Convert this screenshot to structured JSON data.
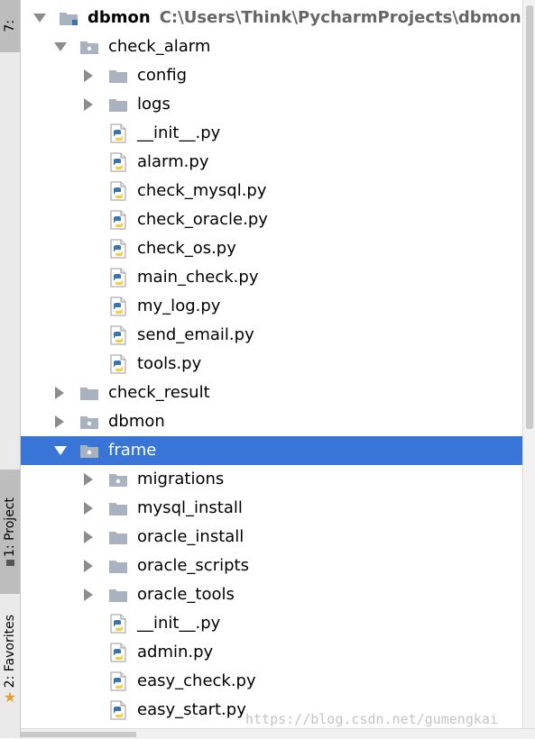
{
  "sidebar": {
    "top_tab": "7:",
    "project_tab": "1: Project",
    "favorites_tab": "2: Favorites"
  },
  "tree": [
    {
      "name": "dbmon",
      "path": "C:\\Users\\Think\\PycharmProjects\\dbmon",
      "type": "module",
      "level": 0,
      "state": "expanded",
      "bold": true
    },
    {
      "name": "check_alarm",
      "type": "package",
      "level": 1,
      "state": "expanded"
    },
    {
      "name": "config",
      "type": "folder",
      "level": 2,
      "state": "collapsed"
    },
    {
      "name": "logs",
      "type": "folder",
      "level": 2,
      "state": "collapsed"
    },
    {
      "name": "__init__.py",
      "type": "python",
      "level": 2,
      "state": "leaf"
    },
    {
      "name": "alarm.py",
      "type": "python",
      "level": 2,
      "state": "leaf"
    },
    {
      "name": "check_mysql.py",
      "type": "python",
      "level": 2,
      "state": "leaf"
    },
    {
      "name": "check_oracle.py",
      "type": "python",
      "level": 2,
      "state": "leaf"
    },
    {
      "name": "check_os.py",
      "type": "python",
      "level": 2,
      "state": "leaf"
    },
    {
      "name": "main_check.py",
      "type": "python",
      "level": 2,
      "state": "leaf"
    },
    {
      "name": "my_log.py",
      "type": "python",
      "level": 2,
      "state": "leaf"
    },
    {
      "name": "send_email.py",
      "type": "python",
      "level": 2,
      "state": "leaf"
    },
    {
      "name": "tools.py",
      "type": "python",
      "level": 2,
      "state": "leaf"
    },
    {
      "name": "check_result",
      "type": "folder",
      "level": 1,
      "state": "collapsed"
    },
    {
      "name": "dbmon",
      "type": "package",
      "level": 1,
      "state": "collapsed"
    },
    {
      "name": "frame",
      "type": "package",
      "level": 1,
      "state": "expanded",
      "selected": true
    },
    {
      "name": "migrations",
      "type": "package",
      "level": 2,
      "state": "collapsed"
    },
    {
      "name": "mysql_install",
      "type": "folder",
      "level": 2,
      "state": "collapsed"
    },
    {
      "name": "oracle_install",
      "type": "folder",
      "level": 2,
      "state": "collapsed"
    },
    {
      "name": "oracle_scripts",
      "type": "folder",
      "level": 2,
      "state": "collapsed"
    },
    {
      "name": "oracle_tools",
      "type": "folder",
      "level": 2,
      "state": "collapsed"
    },
    {
      "name": "__init__.py",
      "type": "python",
      "level": 2,
      "state": "leaf"
    },
    {
      "name": "admin.py",
      "type": "python",
      "level": 2,
      "state": "leaf"
    },
    {
      "name": "easy_check.py",
      "type": "python",
      "level": 2,
      "state": "leaf"
    },
    {
      "name": "easy_start.py",
      "type": "python",
      "level": 2,
      "state": "leaf"
    }
  ],
  "watermark": "https://blog.csdn.net/gumengkai",
  "colors": {
    "selection": "#3875d7",
    "folder": "#a9b3bf",
    "python_blue": "#3b73b1",
    "python_yellow": "#f5cd3c",
    "star": "#e0a030"
  }
}
